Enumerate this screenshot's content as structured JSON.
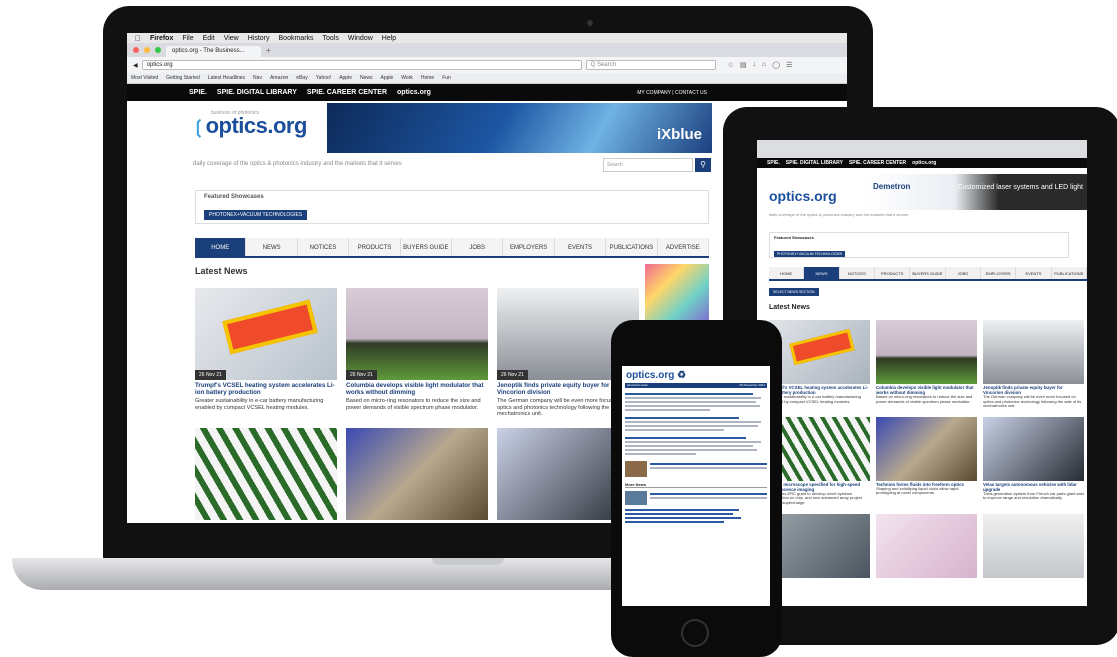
{
  "browser": {
    "menubar": [
      "Firefox",
      "File",
      "Edit",
      "View",
      "History",
      "Bookmarks",
      "Tools",
      "Window",
      "Help"
    ],
    "tab_title": "optics.org - The Business...",
    "url": "optics.org",
    "search_placeholder": "Q Search",
    "bookmarks": [
      "Most Visited",
      "Getting Started",
      "Latest Headlines",
      "Nav",
      "Amazon",
      "eBay",
      "Yahoo!",
      "Apple",
      "News",
      "Apple",
      "Work",
      "Home",
      "Fun"
    ]
  },
  "site": {
    "spie_links": [
      "SPIE.",
      "SPIE. DIGITAL LIBRARY",
      "SPIE. CAREER CENTER",
      "optics.org"
    ],
    "top_right": "MY COMPANY  |  CONTACT US",
    "logo": "optics.org",
    "logo_tag": "business of photonics",
    "banner_brand": "iXblue",
    "tagline": "daily coverage of the optics & photonics industry and the markets that it serves",
    "search_placeholder": "Search",
    "featured_title": "Featured Showcases",
    "featured_chip": "PHOTONEX+VACUUM TECHNOLOGIES",
    "nav": [
      "HOME",
      "NEWS",
      "NOTICES",
      "PRODUCTS",
      "BUYERS GUIDE",
      "JOBS",
      "EMPLOYERS",
      "EVENTS",
      "PUBLICATIONS",
      "ADVERTISE"
    ],
    "latest_news": "Latest News",
    "news": [
      {
        "date": "26 Nov 21",
        "title": "Trumpf's VCSEL heating system accelerates Li-ion battery production",
        "summary": "Greater sustainability in e-car battery manufacturing enabled by compact VCSEL heating modules."
      },
      {
        "date": "26 Nov 21",
        "title": "Columbia develops visible light modulator that works without dimming",
        "summary": "Based on micro-ring resonators to reduce the size and power demands of visible spectrum phase modulator."
      },
      {
        "date": "26 Nov 21",
        "title": "Jenoptik finds private equity buyer for Vincorion division",
        "summary": "The German company will be even more focused on optics and photonics technology following the sale of its mechatronics unit."
      }
    ]
  },
  "tablet": {
    "banner_brand": "Demetron",
    "banner_text": "Customized laser systems and LED light",
    "nav": [
      "HOME",
      "NEWS",
      "NOTICES",
      "PRODUCTS",
      "BUYERS GUIDE",
      "JOBS",
      "EMPLOYERS",
      "EVENTS",
      "PUBLICATIONS"
    ],
    "featured_title": "Featured Showcases",
    "featured_chip": "PHOTONEX+VACUUM TECHNOLOGIES",
    "section_btn": "SELECT NEWS SECTION",
    "latest_news": "Latest News",
    "news": [
      {
        "title": "Trumpf's VCSEL heating system accelerates Li-ion battery production",
        "summary": "Greater sustainability in e-car battery manufacturing enabled by compact VCSEL heating modules."
      },
      {
        "title": "Columbia develops visible light modulator that works without dimming",
        "summary": "Based on micro-ring resonators to reduce the size and power demands of visible spectrum phase modulator."
      },
      {
        "title": "Jenoptik finds private equity buyer for Vincorion division",
        "summary": "The German company will be even more focused on optics and photonics technology following the sale of its mechatronics unit."
      },
      {
        "title": "Single microscope specified for high-speed fluorescence imaging",
        "summary": "Innovates ERC grant to develop novel systems information on chip, and new advanced array project targets supercharge"
      },
      {
        "title": "Technion forms fluids into freeform optics",
        "summary": "Shaping and solidifying liquid could allow rapid prototyping at novel components."
      },
      {
        "title": "Velas targets autonomous vehicles with lidar upgrade",
        "summary": "Third-generation system from French car parts giant said to improve range and resolution dramatically."
      }
    ]
  },
  "phone": {
    "logo": "optics.org",
    "date": "26 November 2021",
    "section": "photonics news",
    "more": "More News"
  },
  "colors": {
    "brand": "#1a3f7a",
    "accent": "#3aa0da"
  }
}
